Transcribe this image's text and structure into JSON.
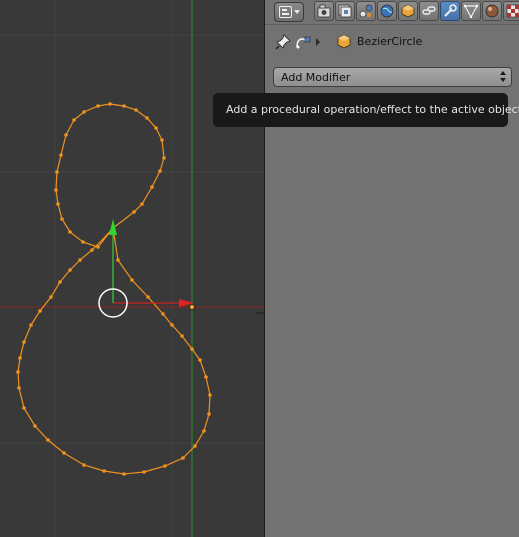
{
  "viewport": {
    "grid_color": "#444444",
    "curve_color": "#f0921e",
    "x_axis_color": "#a32020",
    "y_axis_color": "#2f8f2f"
  },
  "properties": {
    "editor_type_icon": "properties-editor-icon",
    "tabs": [
      {
        "name": "render-icon",
        "active": false
      },
      {
        "name": "render-layers-icon",
        "active": false
      },
      {
        "name": "scene-icon",
        "active": false
      },
      {
        "name": "world-icon",
        "active": false
      },
      {
        "name": "object-icon",
        "active": false
      },
      {
        "name": "constraints-icon",
        "active": false
      },
      {
        "name": "modifiers-icon",
        "active": true
      },
      {
        "name": "data-icon",
        "active": false
      },
      {
        "name": "material-icon",
        "active": false
      },
      {
        "name": "texture-icon",
        "active": false
      }
    ],
    "breadcrumb": {
      "object_name": "BezierCircle"
    },
    "add_modifier_label": "Add Modifier"
  },
  "tooltip": {
    "text": "Add a procedural operation/effect to the active object."
  }
}
